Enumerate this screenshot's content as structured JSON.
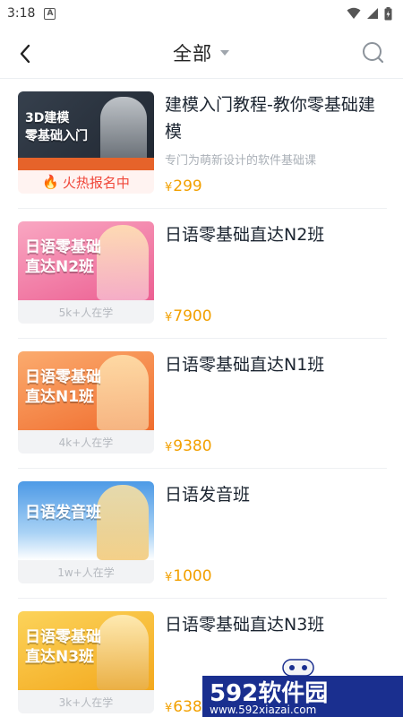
{
  "status_bar": {
    "time": "3:18",
    "a_badge": "A"
  },
  "header": {
    "title": "全部"
  },
  "courses": [
    {
      "title": "建模入门教程-教你零基础建模",
      "subtitle": "专门为萌新设计的软件基础课",
      "badge": "火热报名中",
      "currency": "¥",
      "price": "299",
      "cover_text": "3D建模\n零基础入门",
      "cover_color": "#2b3440",
      "accent": "#e65a24"
    },
    {
      "title": "日语零基础直达N2班",
      "subtitle": "",
      "badge": "5k+人在学",
      "currency": "¥",
      "price": "7900",
      "cover_text": "日语零基础\n直达N2班",
      "cover_color": "#f17aa4",
      "accent": "#e84a7b"
    },
    {
      "title": "日语零基础直达N1班",
      "subtitle": "",
      "badge": "4k+人在学",
      "currency": "¥",
      "price": "9380",
      "cover_text": "日语零基础\n直达N1班",
      "cover_color": "#f88b4c",
      "accent": "#ef6a2f"
    },
    {
      "title": "日语发音班",
      "subtitle": "",
      "badge": "1w+人在学",
      "currency": "¥",
      "price": "1000",
      "cover_text": "日语发音班",
      "cover_color": "#5aa6ea",
      "accent": "#2f7fd6"
    },
    {
      "title": "日语零基础直达N3班",
      "subtitle": "",
      "badge": "3k+人在学",
      "currency": "¥",
      "price": "638",
      "cover_text": "日语零基础\n直达N3班",
      "cover_color": "#f8c23a",
      "accent": "#f0a019"
    }
  ],
  "watermark": {
    "text": "592软件园",
    "url": "www.592xiazai.com"
  },
  "colors": {
    "price": "#f2a000",
    "hot": "#f0473a"
  }
}
